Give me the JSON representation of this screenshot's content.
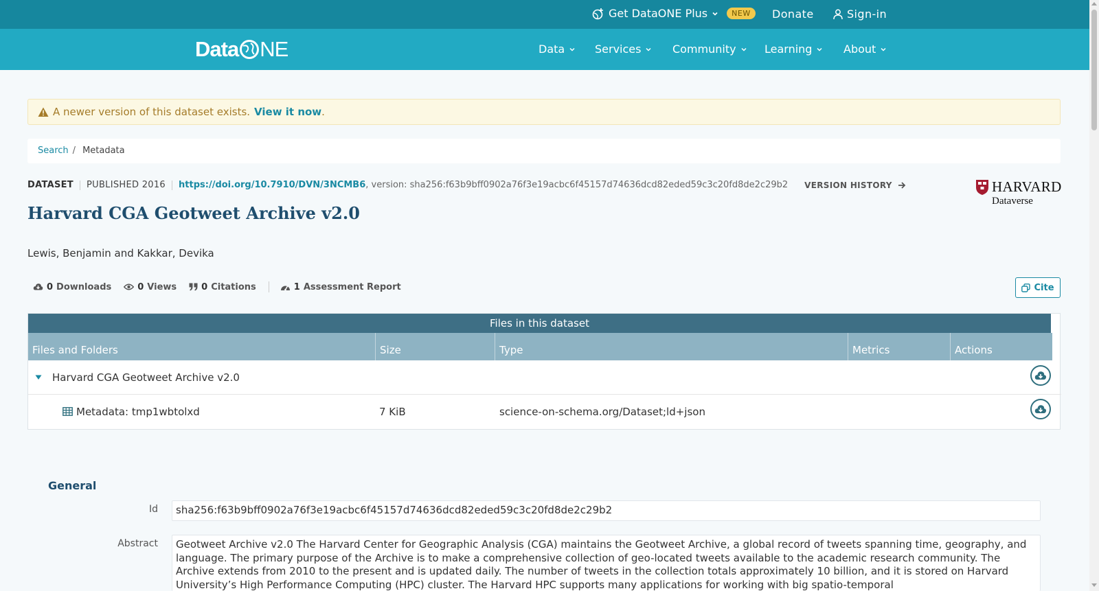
{
  "topbar": {
    "plus_label": "Get DataONE Plus",
    "new_badge": "NEW",
    "donate": "Donate",
    "signin": "Sign-in"
  },
  "nav": {
    "logo_text": "Data",
    "logo_suffix": "NE",
    "items": [
      {
        "label": "Data"
      },
      {
        "label": "Services"
      },
      {
        "label": "Community"
      },
      {
        "label": "Learning"
      },
      {
        "label": "About"
      }
    ]
  },
  "alert": {
    "message": "A newer version of this dataset exists.",
    "link": "View it now",
    "period": "."
  },
  "breadcrumb": {
    "search": "Search",
    "separator": "/",
    "current": "Metadata"
  },
  "dataset": {
    "type_label": "DATASET",
    "published": "PUBLISHED 2016",
    "doi": "https://doi.org/10.7910/DVN/3NCMB6",
    "version": ", version: sha256:f63b9bff0902a76f3e19acbc6f45157d74636dcd82eded59c3c20fd8de2c29b2",
    "version_history": "VERSION HISTORY",
    "title": "Harvard CGA Geotweet Archive v2.0",
    "authors": "Lewis, Benjamin and Kakkar, Devika",
    "repository_logo": {
      "name": "HARVARD",
      "sub": "Dataverse"
    }
  },
  "metrics": {
    "downloads_count": "0",
    "downloads_label": "Downloads",
    "views_count": "0",
    "views_label": "Views",
    "citations_count": "0",
    "citations_label": "Citations",
    "assessment_count": "1",
    "assessment_label": "Assessment Report",
    "cite_button": "Cite"
  },
  "files": {
    "caption": "Files in this dataset",
    "columns": [
      "Files and Folders",
      "Size",
      "Type",
      "Metrics",
      "Actions"
    ],
    "folder_name": "Harvard CGA Geotweet Archive v2.0",
    "rows": [
      {
        "name": "Metadata: tmp1wbtolxd",
        "size": "7 KiB",
        "type": "science-on-schema.org/Dataset;ld+json"
      }
    ]
  },
  "general": {
    "heading": "General",
    "id_label": "Id",
    "id_value": "sha256:f63b9bff0902a76f3e19acbc6f45157d74636dcd82eded59c3c20fd8de2c29b2",
    "abstract_label": "Abstract",
    "abstract_value": "Geotweet Archive v2.0 The Harvard Center for Geographic Analysis (CGA) maintains the Geotweet Archive, a global record of tweets spanning time, geography, and language. The primary purpose of the Archive is to make a comprehensive collection of geo-located tweets available to the academic research community. The Archive extends from 2010 to the present and is updated daily. The number of tweets in the collection totals approximately 10 billion, and it is stored on Harvard University’s High Performance Computing (HPC) cluster. The Harvard HPC supports many applications for working with big spatio-temporal"
  },
  "colors": {
    "topbar": "#16879e",
    "navbar": "#22aac3",
    "accent": "#1a8aa3",
    "title": "#1f4e6e",
    "table_caption": "#3e6f85",
    "table_header": "#8eb3c3",
    "alert_bg": "#fcf8e3"
  }
}
